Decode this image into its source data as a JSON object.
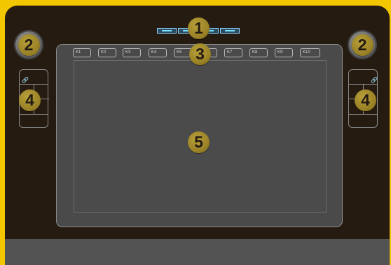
{
  "device": {
    "top_status": {
      "segments": 5
    },
    "express_keys": [
      "K1",
      "K2",
      "K3",
      "K4",
      "K5",
      "K6",
      "K7",
      "K8",
      "K9",
      "K10"
    ],
    "callouts": {
      "status_indicators": "1",
      "left_dial": "2",
      "right_dial": "2",
      "express_keys": "3",
      "left_touch_panel": "4",
      "right_touch_panel": "4",
      "active_area": "5"
    },
    "icons": {
      "left_panel_icon": "link-icon",
      "right_panel_icon": "link-icon"
    },
    "colors": {
      "background": "#f3c700",
      "device": "#261b11",
      "surface": "#4a4a4a",
      "bottom_panel": "#535353",
      "badge": "#9b8327",
      "status_led": "#77e2ff"
    }
  }
}
